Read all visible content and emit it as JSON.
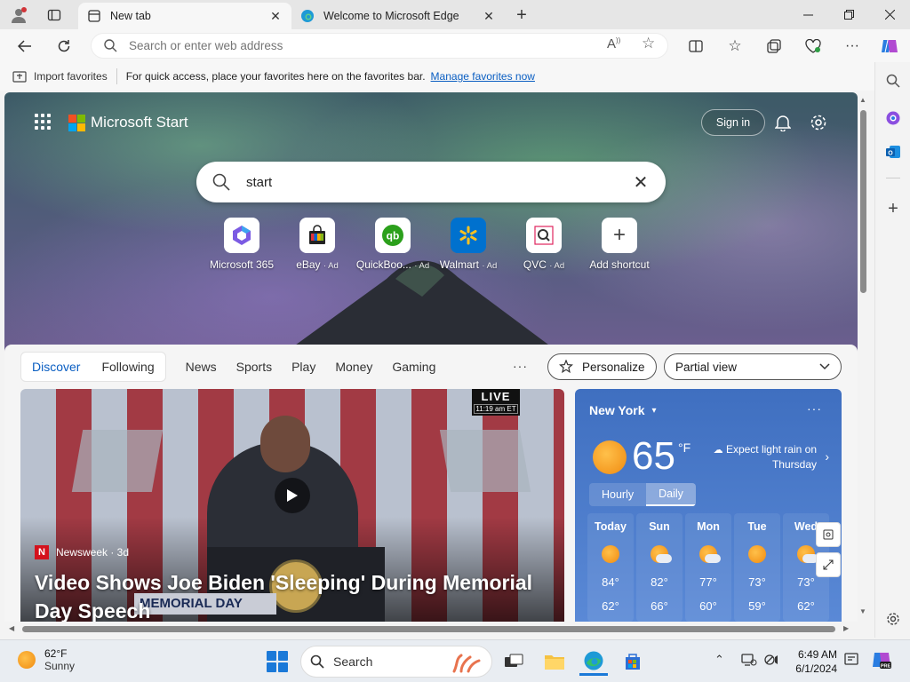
{
  "browser": {
    "tabs": [
      {
        "title": "New tab",
        "active": true
      },
      {
        "title": "Welcome to Microsoft Edge",
        "active": false
      }
    ],
    "address_placeholder": "Search or enter web address",
    "favorites_bar": {
      "import_label": "Import favorites",
      "message": "For quick access, place your favorites here on the favorites bar.",
      "manage_link": "Manage favorites now"
    }
  },
  "start_page": {
    "brand": "Microsoft Start",
    "sign_in": "Sign in",
    "search_value": "start",
    "shortcuts": [
      {
        "label": "Microsoft 365",
        "ad": ""
      },
      {
        "label": "eBay",
        "ad": "· Ad"
      },
      {
        "label": "QuickBoo...",
        "ad": "· Ad"
      },
      {
        "label": "Walmart",
        "ad": "· Ad"
      },
      {
        "label": "QVC",
        "ad": "· Ad"
      },
      {
        "label": "Add shortcut",
        "ad": ""
      }
    ],
    "feed_tabs": [
      "Discover",
      "Following"
    ],
    "categories": [
      "News",
      "Sports",
      "Play",
      "Money",
      "Gaming"
    ],
    "more": "···",
    "personalize": "Personalize",
    "view_select": "Partial view",
    "hero": {
      "live": "LIVE",
      "live_time": "11:19 am ET",
      "podium_text": "MEMORIAL DAY",
      "source_badge": "N",
      "source": "Newsweek · 3d",
      "headline": "Video Shows Joe Biden 'Sleeping' During Memorial Day Speech"
    },
    "weather": {
      "city": "New York",
      "temp": "65",
      "unit": "°F",
      "forecast": "Expect light rain on Thursday",
      "toggle": [
        "Hourly",
        "Daily"
      ],
      "days": [
        {
          "name": "Today",
          "hi": "84°",
          "lo": "62°",
          "icon": "sunny"
        },
        {
          "name": "Sun",
          "hi": "82°",
          "lo": "66°",
          "icon": "partly-cloudy"
        },
        {
          "name": "Mon",
          "hi": "77°",
          "lo": "60°",
          "icon": "partly-cloudy"
        },
        {
          "name": "Tue",
          "hi": "73°",
          "lo": "59°",
          "icon": "sunny"
        },
        {
          "name": "Wed",
          "hi": "73°",
          "lo": "62°",
          "icon": "partly-cloudy"
        }
      ]
    }
  },
  "taskbar": {
    "weather_temp": "62°F",
    "weather_desc": "Sunny",
    "search_label": "Search",
    "time": "6:49 AM",
    "date": "6/1/2024"
  },
  "colors": {
    "accent": "#0a5ec2",
    "weather_bg": "#4a7ccc",
    "start_blue": "#1b79d8"
  }
}
